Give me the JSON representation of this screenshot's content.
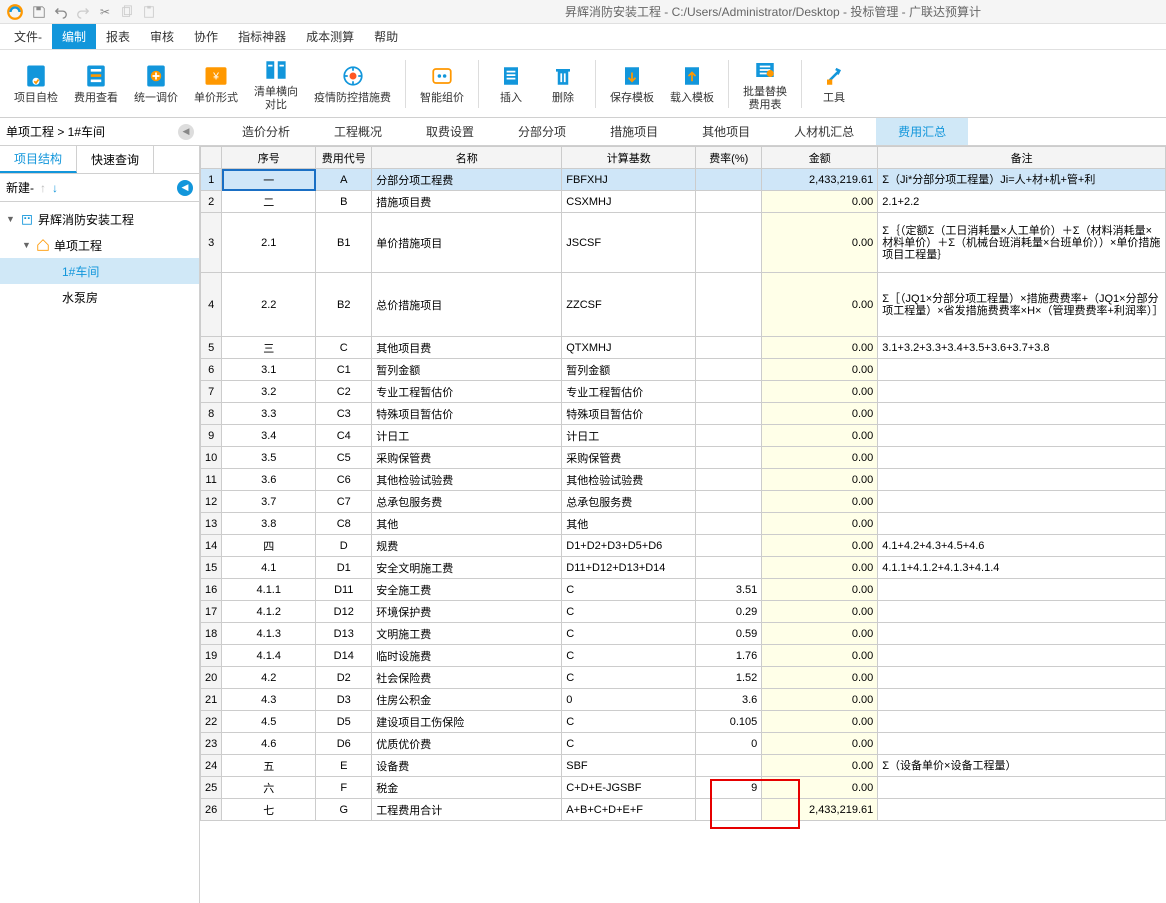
{
  "app_title": "昇辉消防安装工程 - C:/Users/Administrator/Desktop - 投标管理 - 广联达预算计",
  "menus": [
    "文件-",
    "编制",
    "报表",
    "审核",
    "协作",
    "指标神器",
    "成本测算",
    "帮助"
  ],
  "active_menu": 1,
  "ribbon": [
    {
      "label": "项目自检"
    },
    {
      "label": "费用查看"
    },
    {
      "label": "统一调价"
    },
    {
      "label": "单价形式"
    },
    {
      "label": "清单横向\n对比"
    },
    {
      "label": "疫情防控措施费"
    },
    {
      "label": "智能组价"
    },
    {
      "label": "插入"
    },
    {
      "label": "删除"
    },
    {
      "label": "保存模板"
    },
    {
      "label": "载入模板"
    },
    {
      "label": "批量替换\n费用表"
    },
    {
      "label": "工具"
    }
  ],
  "breadcrumb": "单项工程 > 1#车间",
  "sub_tabs": [
    "造价分析",
    "工程概况",
    "取费设置",
    "分部分项",
    "措施项目",
    "其他项目",
    "人材机汇总",
    "费用汇总"
  ],
  "active_sub_tab": 7,
  "left_tabs": [
    "项目结构",
    "快速查询"
  ],
  "left_toolbar_new": "新建-",
  "tree": {
    "root": "昇辉消防安装工程",
    "l1": "单项工程",
    "l2a": "1#车间",
    "l2b": "水泵房"
  },
  "table_headers": [
    "",
    "序号",
    "费用代号",
    "名称",
    "计算基数",
    "费率(%)",
    "金额",
    "备注"
  ],
  "rows": [
    {
      "n": 1,
      "seq": "一",
      "code": "A",
      "name": "分部分项工程费",
      "base": "FBFXHJ",
      "rate": "",
      "amount": "2,433,219.61",
      "remark": "Σ（Ji*分部分项工程量）Ji=人+材+机+管+利",
      "sel": true
    },
    {
      "n": 2,
      "seq": "二",
      "code": "B",
      "name": "措施项目费",
      "base": "CSXMHJ",
      "rate": "",
      "amount": "0.00",
      "remark": "2.1+2.2"
    },
    {
      "n": 3,
      "seq": "2.1",
      "code": "B1",
      "name": "单价措施项目",
      "base": "JSCSF",
      "rate": "",
      "amount": "0.00",
      "remark": "Σ｛（定额Σ（工日消耗量×人工单价）＋Σ（材料消耗量×材料单价）＋Σ（机械台班消耗量×台班单价））×单价措施项目工程量｝",
      "tall": true
    },
    {
      "n": 4,
      "seq": "2.2",
      "code": "B2",
      "name": "总价措施项目",
      "base": "ZZCSF",
      "rate": "",
      "amount": "0.00",
      "remark": "Σ［（JQ1×分部分项工程量）×措施费费率+（JQ1×分部分项工程量）×省发措施费费率×H×（管理费费率+利润率）］",
      "taller": true
    },
    {
      "n": 5,
      "seq": "三",
      "code": "C",
      "name": "其他项目费",
      "base": "QTXMHJ",
      "rate": "",
      "amount": "0.00",
      "remark": "3.1+3.2+3.3+3.4+3.5+3.6+3.7+3.8"
    },
    {
      "n": 6,
      "seq": "3.1",
      "code": "C1",
      "name": "暂列金额",
      "base": "暂列金额",
      "rate": "",
      "amount": "0.00",
      "remark": ""
    },
    {
      "n": 7,
      "seq": "3.2",
      "code": "C2",
      "name": "专业工程暂估价",
      "base": "专业工程暂估价",
      "rate": "",
      "amount": "0.00",
      "remark": ""
    },
    {
      "n": 8,
      "seq": "3.3",
      "code": "C3",
      "name": "特殊项目暂估价",
      "base": "特殊项目暂估价",
      "rate": "",
      "amount": "0.00",
      "remark": ""
    },
    {
      "n": 9,
      "seq": "3.4",
      "code": "C4",
      "name": "计日工",
      "base": "计日工",
      "rate": "",
      "amount": "0.00",
      "remark": ""
    },
    {
      "n": 10,
      "seq": "3.5",
      "code": "C5",
      "name": "采购保管费",
      "base": "采购保管费",
      "rate": "",
      "amount": "0.00",
      "remark": ""
    },
    {
      "n": 11,
      "seq": "3.6",
      "code": "C6",
      "name": "其他检验试验费",
      "base": "其他检验试验费",
      "rate": "",
      "amount": "0.00",
      "remark": ""
    },
    {
      "n": 12,
      "seq": "3.7",
      "code": "C7",
      "name": "总承包服务费",
      "base": "总承包服务费",
      "rate": "",
      "amount": "0.00",
      "remark": ""
    },
    {
      "n": 13,
      "seq": "3.8",
      "code": "C8",
      "name": "其他",
      "base": "其他",
      "rate": "",
      "amount": "0.00",
      "remark": ""
    },
    {
      "n": 14,
      "seq": "四",
      "code": "D",
      "name": "规费",
      "base": "D1+D2+D3+D5+D6",
      "rate": "",
      "amount": "0.00",
      "remark": "4.1+4.2+4.3+4.5+4.6"
    },
    {
      "n": 15,
      "seq": "4.1",
      "code": "D1",
      "name": "安全文明施工费",
      "base": "D11+D12+D13+D14",
      "rate": "",
      "amount": "0.00",
      "remark": "4.1.1+4.1.2+4.1.3+4.1.4"
    },
    {
      "n": 16,
      "seq": "4.1.1",
      "code": "D11",
      "name": "安全施工费",
      "base": "C",
      "rate": "3.51",
      "amount": "0.00",
      "remark": ""
    },
    {
      "n": 17,
      "seq": "4.1.2",
      "code": "D12",
      "name": "环境保护费",
      "base": "C",
      "rate": "0.29",
      "amount": "0.00",
      "remark": ""
    },
    {
      "n": 18,
      "seq": "4.1.3",
      "code": "D13",
      "name": "文明施工费",
      "base": "C",
      "rate": "0.59",
      "amount": "0.00",
      "remark": ""
    },
    {
      "n": 19,
      "seq": "4.1.4",
      "code": "D14",
      "name": "临时设施费",
      "base": "C",
      "rate": "1.76",
      "amount": "0.00",
      "remark": ""
    },
    {
      "n": 20,
      "seq": "4.2",
      "code": "D2",
      "name": "社会保险费",
      "base": "C",
      "rate": "1.52",
      "amount": "0.00",
      "remark": ""
    },
    {
      "n": 21,
      "seq": "4.3",
      "code": "D3",
      "name": "住房公积金",
      "base": "0",
      "rate": "3.6",
      "amount": "0.00",
      "remark": ""
    },
    {
      "n": 22,
      "seq": "4.5",
      "code": "D5",
      "name": "建设项目工伤保险",
      "base": "C",
      "rate": "0.105",
      "amount": "0.00",
      "remark": ""
    },
    {
      "n": 23,
      "seq": "4.6",
      "code": "D6",
      "name": "优质优价费",
      "base": "C",
      "rate": "0",
      "amount": "0.00",
      "remark": ""
    },
    {
      "n": 24,
      "seq": "五",
      "code": "E",
      "name": "设备费",
      "base": "SBF",
      "rate": "",
      "amount": "0.00",
      "remark": "Σ（设备单价×设备工程量）"
    },
    {
      "n": 25,
      "seq": "六",
      "code": "F",
      "name": "税金",
      "base": "C+D+E-JGSBF",
      "rate": "9",
      "amount": "0.00",
      "remark": ""
    },
    {
      "n": 26,
      "seq": "七",
      "code": "G",
      "name": "工程费用合计",
      "base": "A+B+C+D+E+F",
      "rate": "",
      "amount": "2,433,219.61",
      "remark": ""
    }
  ]
}
